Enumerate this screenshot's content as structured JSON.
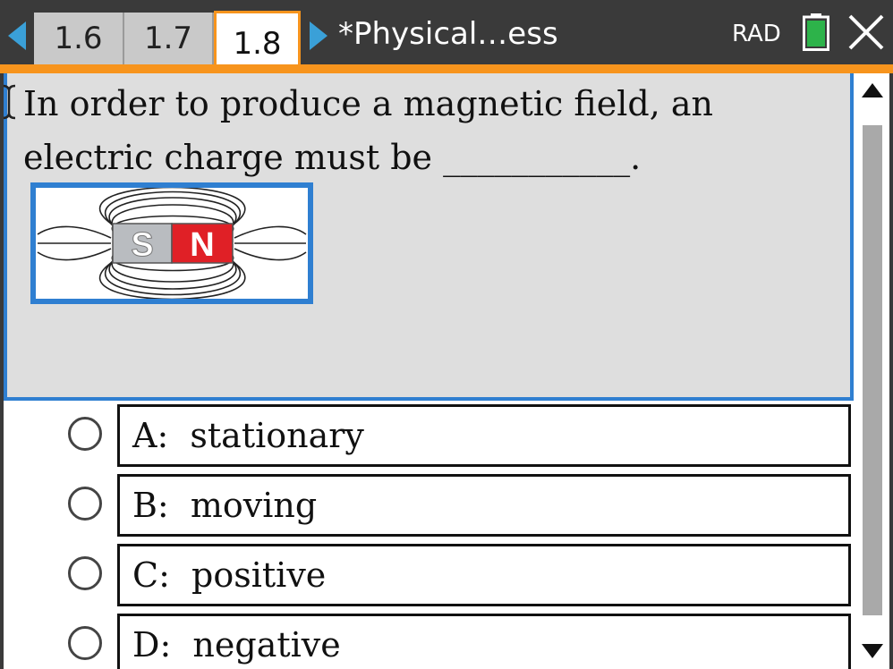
{
  "toolbar": {
    "tabs": [
      {
        "label": "1.6",
        "active": false
      },
      {
        "label": "1.7",
        "active": false
      },
      {
        "label": "1.8",
        "active": true
      }
    ],
    "document_title": "*Physical…ess",
    "angle_mode": "RAD",
    "icons": {
      "prev": "triangle-left-icon",
      "next": "triangle-right-icon",
      "battery": "battery-icon",
      "close": "close-x-icon"
    },
    "colors": {
      "bar": "#3a3a3a",
      "accent_orange": "#f7941d",
      "arrow_blue": "#3aa0d8",
      "battery_green": "#2db34a"
    }
  },
  "question": {
    "line1": "In order to produce a magnetic field, an",
    "line2": "electric charge must be ___________.",
    "image": {
      "south_label": "S",
      "north_label": "N",
      "south_color": "#b9bcc0",
      "north_color": "#e02026"
    }
  },
  "choices": [
    {
      "text": "A:  stationary"
    },
    {
      "text": "B:  moving"
    },
    {
      "text": "C:  positive"
    },
    {
      "text": "D:  negative"
    }
  ],
  "colors": {
    "selection_blue": "#2f7fd1",
    "question_bg": "#dedede"
  }
}
